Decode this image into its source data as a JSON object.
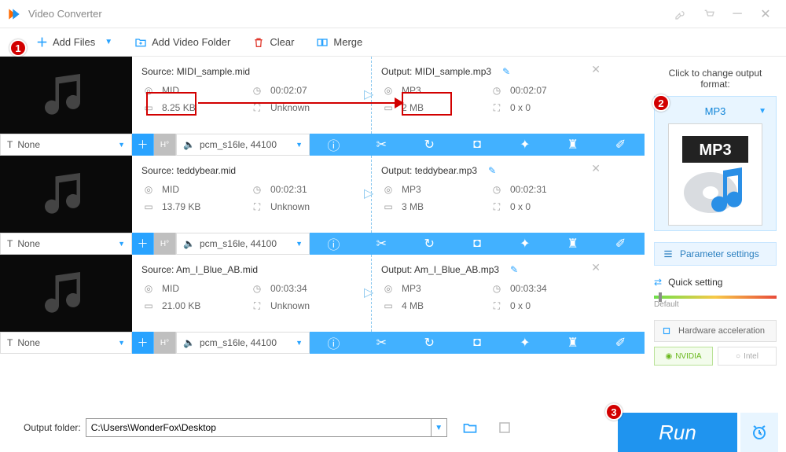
{
  "window": {
    "title": "Video Converter"
  },
  "toolbar": {
    "add_files": "Add Files",
    "add_folder": "Add Video Folder",
    "clear": "Clear",
    "merge": "Merge"
  },
  "entries": [
    {
      "source_label": "Source: MIDI_sample.mid",
      "output_label": "Output: MIDI_sample.mp3",
      "src_fmt": "MID",
      "src_dur": "00:02:07",
      "src_size": "8.25 KB",
      "src_res": "Unknown",
      "out_fmt": "MP3",
      "out_dur": "00:02:07",
      "out_size": "2 MB",
      "out_res": "0 x 0",
      "sub_label": "None",
      "codec": "pcm_s16le, 44100"
    },
    {
      "source_label": "Source: teddybear.mid",
      "output_label": "Output: teddybear.mp3",
      "src_fmt": "MID",
      "src_dur": "00:02:31",
      "src_size": "13.79 KB",
      "src_res": "Unknown",
      "out_fmt": "MP3",
      "out_dur": "00:02:31",
      "out_size": "3 MB",
      "out_res": "0 x 0",
      "sub_label": "None",
      "codec": "pcm_s16le, 44100"
    },
    {
      "source_label": "Source: Am_I_Blue_AB.mid",
      "output_label": "Output: Am_I_Blue_AB.mp3",
      "src_fmt": "MID",
      "src_dur": "00:03:34",
      "src_size": "21.00 KB",
      "src_res": "Unknown",
      "out_fmt": "MP3",
      "out_dur": "00:03:34",
      "out_size": "4 MB",
      "out_res": "0 x 0",
      "sub_label": "None",
      "codec": "pcm_s16le, 44100"
    }
  ],
  "side": {
    "heading": "Click to change output format:",
    "format": "MP3",
    "param_btn": "Parameter settings",
    "quick": "Quick setting",
    "slider_label": "Default",
    "hw": "Hardware acceleration",
    "nvidia": "NVIDIA",
    "intel": "Intel"
  },
  "bottom": {
    "label": "Output folder:",
    "path": "C:\\Users\\WonderFox\\Desktop",
    "run": "Run"
  },
  "annotations": {
    "a1": "1",
    "a2": "2",
    "a3": "3"
  }
}
